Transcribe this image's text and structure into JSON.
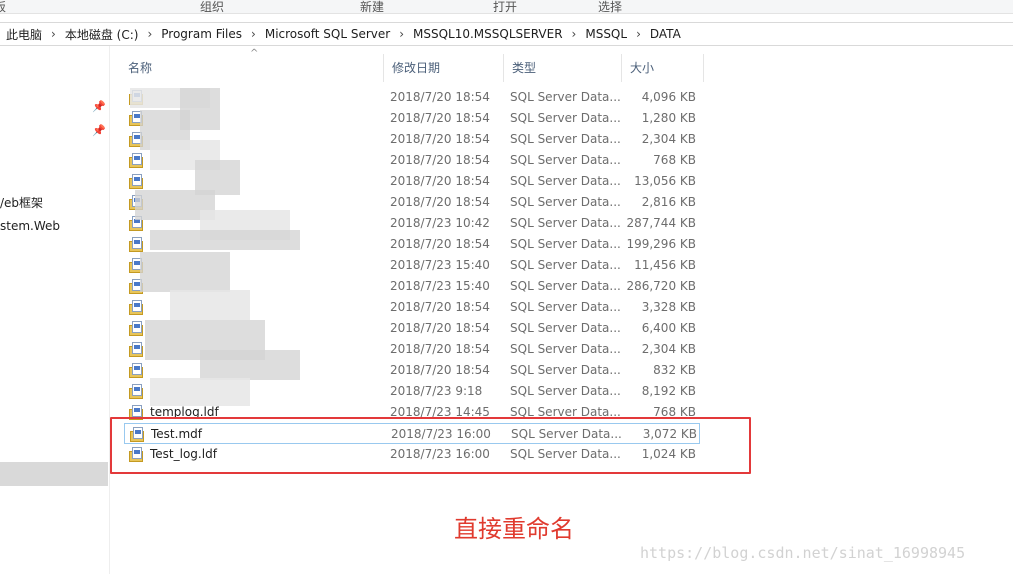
{
  "ribbon": {
    "groups": [
      "板",
      "组织",
      "新建",
      "打开",
      "选择"
    ]
  },
  "breadcrumbs": [
    "此电脑",
    "本地磁盘 (C:)",
    "Program Files",
    "Microsoft SQL Server",
    "MSSQL10.MSSQLSERVER",
    "MSSQL",
    "DATA"
  ],
  "navpane": {
    "items": [
      "/eb框架",
      "stem.Web"
    ]
  },
  "columns": {
    "name": "名称",
    "date": "修改日期",
    "type": "类型",
    "size": "大小"
  },
  "files": [
    {
      "name": "",
      "date": "2018/7/20 18:54",
      "type": "SQL Server Data...",
      "size": "4,096 KB"
    },
    {
      "name": "",
      "date": "2018/7/20 18:54",
      "type": "SQL Server Data...",
      "size": "1,280 KB"
    },
    {
      "name": "",
      "date": "2018/7/20 18:54",
      "type": "SQL Server Data...",
      "size": "2,304 KB"
    },
    {
      "name": "",
      "date": "2018/7/20 18:54",
      "type": "SQL Server Data...",
      "size": "768 KB"
    },
    {
      "name": "",
      "date": "2018/7/20 18:54",
      "type": "SQL Server Data...",
      "size": "13,056 KB"
    },
    {
      "name": "",
      "date": "2018/7/20 18:54",
      "type": "SQL Server Data...",
      "size": "2,816 KB"
    },
    {
      "name": "",
      "date": "2018/7/23 10:42",
      "type": "SQL Server Data...",
      "size": "287,744 KB"
    },
    {
      "name": "",
      "date": "2018/7/20 18:54",
      "type": "SQL Server Data...",
      "size": "199,296 KB"
    },
    {
      "name": "",
      "date": "2018/7/23 15:40",
      "type": "SQL Server Data...",
      "size": "11,456 KB"
    },
    {
      "name": "",
      "date": "2018/7/23 15:40",
      "type": "SQL Server Data...",
      "size": "286,720 KB"
    },
    {
      "name": "",
      "date": "2018/7/20 18:54",
      "type": "SQL Server Data...",
      "size": "3,328 KB"
    },
    {
      "name": "",
      "date": "2018/7/20 18:54",
      "type": "SQL Server Data...",
      "size": "6,400 KB"
    },
    {
      "name": "",
      "date": "2018/7/20 18:54",
      "type": "SQL Server Data...",
      "size": "2,304 KB"
    },
    {
      "name": "",
      "date": "2018/7/20 18:54",
      "type": "SQL Server Data...",
      "size": "832 KB"
    },
    {
      "name": "",
      "date": "2018/7/23 9:18",
      "type": "SQL Server Data...",
      "size": "8,192 KB"
    },
    {
      "name": "templog.ldf",
      "date": "2018/7/23 14:45",
      "type": "SQL Server Data...",
      "size": "768 KB"
    },
    {
      "name": "Test.mdf",
      "date": "2018/7/23 16:00",
      "type": "SQL Server Data...",
      "size": "3,072 KB"
    },
    {
      "name": "Test_log.ldf",
      "date": "2018/7/23 16:00",
      "type": "SQL Server Data...",
      "size": "1,024 KB"
    }
  ],
  "annotation": "直接重命名",
  "watermark": "https://blog.csdn.net/sinat_16998945",
  "colors": {
    "highlight_box": "#e3393a",
    "annotation_text": "#e03a2e",
    "selection_border": "#99c9ef"
  }
}
